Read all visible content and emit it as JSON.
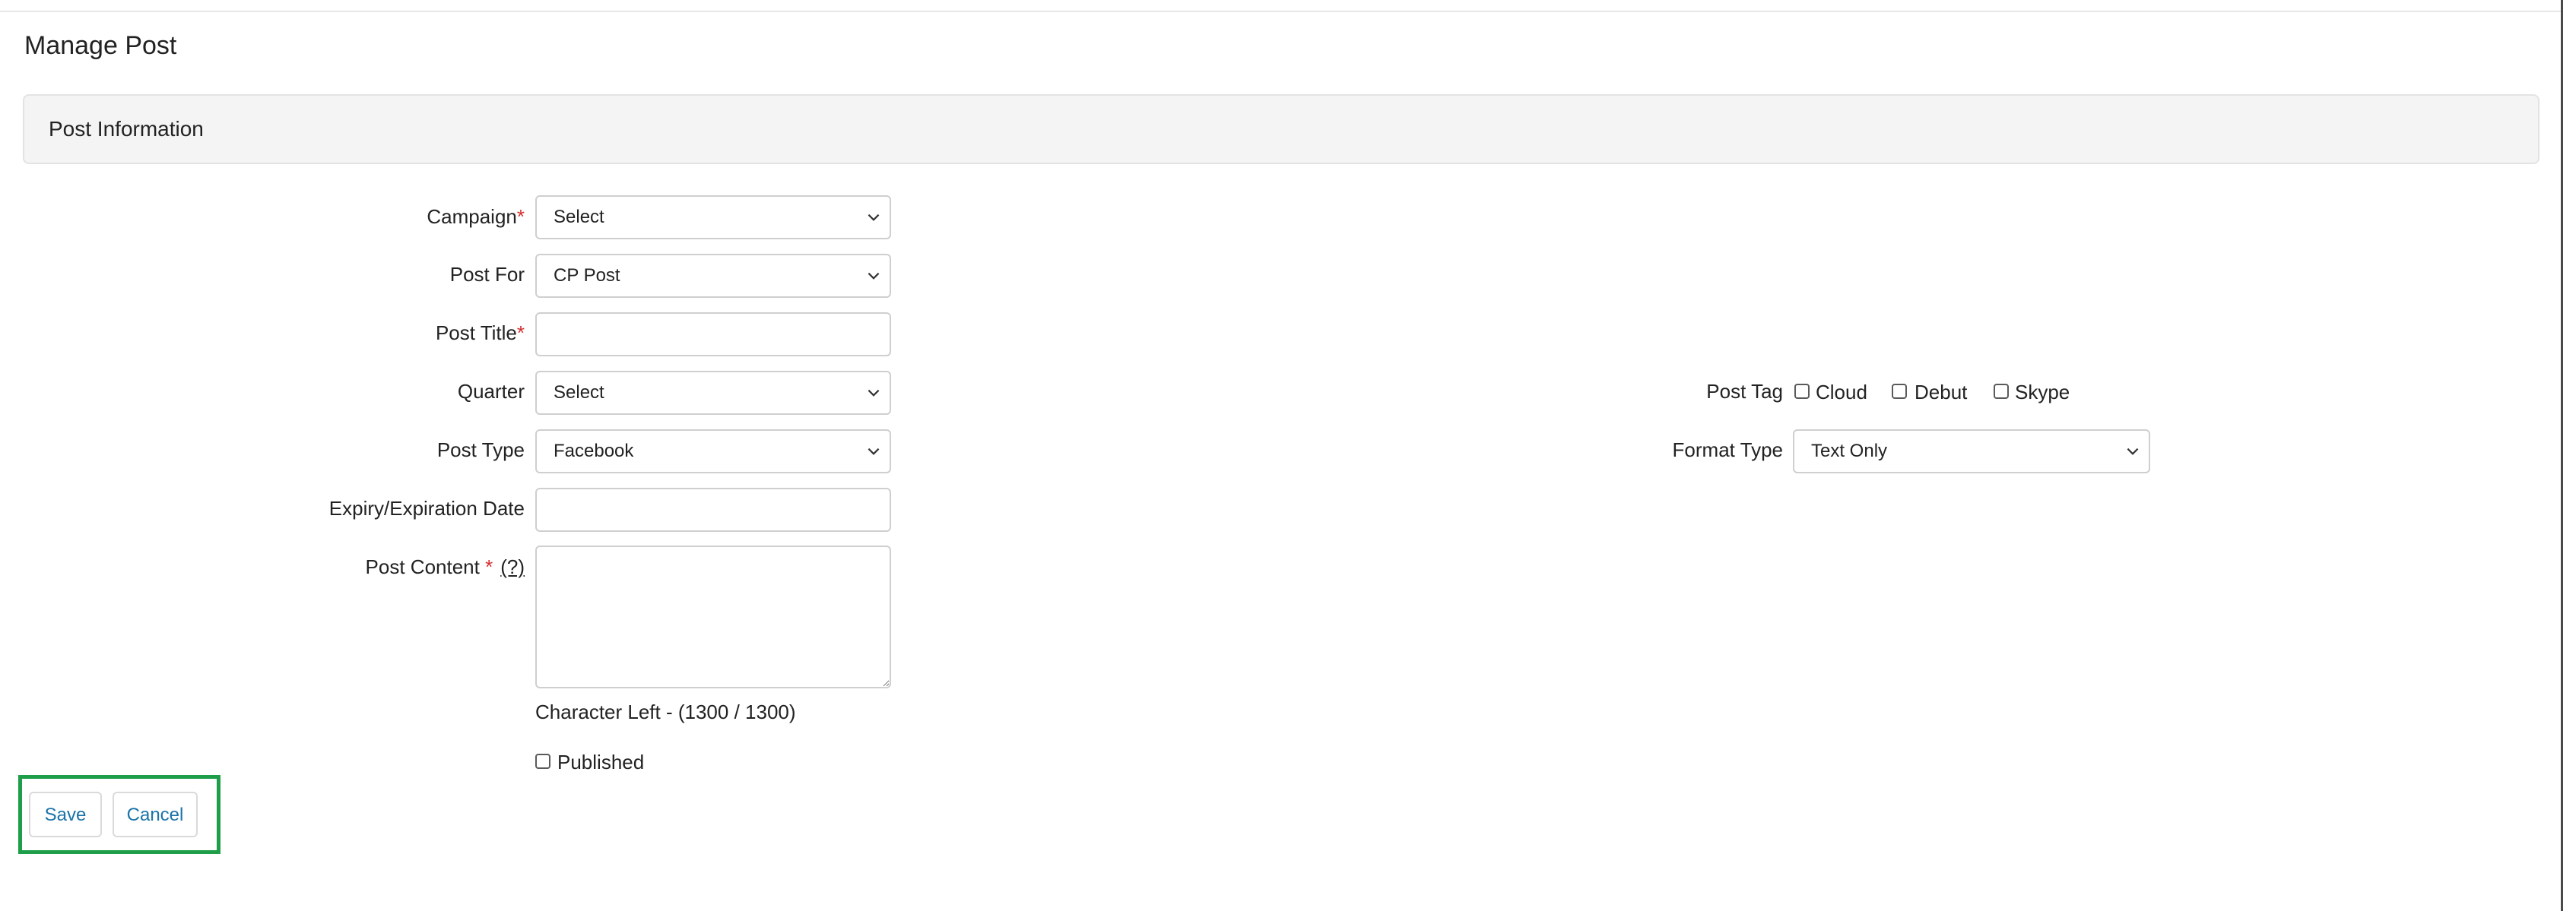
{
  "page": {
    "title": "Manage Post"
  },
  "section": {
    "title": "Post Information"
  },
  "form": {
    "campaign": {
      "label": "Campaign",
      "required_mark": "*",
      "value": "Select"
    },
    "post_for": {
      "label": "Post For",
      "value": "CP Post"
    },
    "post_title": {
      "label": "Post Title",
      "required_mark": "*",
      "value": ""
    },
    "quarter": {
      "label": "Quarter",
      "value": "Select"
    },
    "post_type": {
      "label": "Post Type",
      "value": "Facebook"
    },
    "expiry_date": {
      "label": "Expiry/Expiration Date",
      "value": ""
    },
    "post_content": {
      "label": "Post Content",
      "required_mark": "*",
      "help": "(?)",
      "value": ""
    },
    "char_left": "Character Left - (1300 / 1300)",
    "published": {
      "label": "Published",
      "checked": false
    },
    "post_tag": {
      "label": "Post Tag",
      "options": [
        {
          "label": "Cloud",
          "checked": false
        },
        {
          "label": "Debut",
          "checked": false
        },
        {
          "label": "Skype",
          "checked": false
        }
      ]
    },
    "format_type": {
      "label": "Format Type",
      "value": "Text Only"
    }
  },
  "actions": {
    "save_label": "Save",
    "cancel_label": "Cancel"
  },
  "colors": {
    "accent": "#1a73a8",
    "required": "#d32f2f",
    "highlight": "#1e9e48"
  },
  "icons": {
    "dropdown": "chevron-down-icon"
  }
}
